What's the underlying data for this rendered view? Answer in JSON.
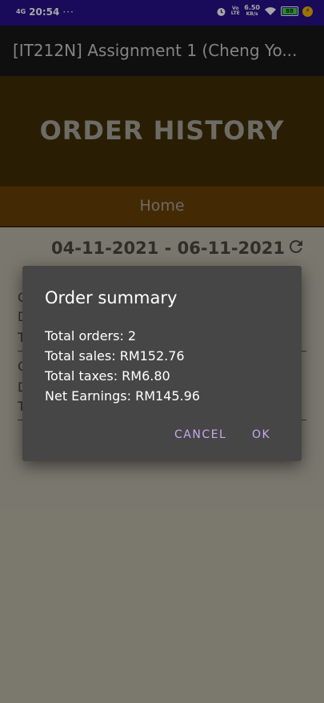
{
  "status_bar": {
    "network": "4G",
    "network_sub": "ıl",
    "time": "20:54",
    "dots": "···",
    "volte": "Vo LTE",
    "speed_value": "6.50",
    "speed_unit": "KB/s",
    "battery": "88"
  },
  "app_bar": {
    "title": "[IT212N] Assignment 1 (Cheng Yo..."
  },
  "banner": {
    "title": "ORDER HISTORY"
  },
  "nav": {
    "home_label": "Home"
  },
  "date_range": {
    "label": "04-11-2021 - 06-11-2021"
  },
  "background_list": {
    "letters": [
      "O",
      "D",
      "T",
      "O",
      "D",
      "T"
    ]
  },
  "dialog": {
    "title": "Order summary",
    "total_orders": "Total orders: 2",
    "total_sales": "Total sales: RM152.76",
    "total_taxes": "Total taxes: RM6.80",
    "net_earnings": "Net Earnings: RM145.96",
    "cancel_label": "CANCEL",
    "ok_label": "OK"
  },
  "colors": {
    "status_bar_bg": "#27128a",
    "banner_bg": "#3f2f05",
    "home_tab_bg": "#694107",
    "dialog_bg": "#464646",
    "dialog_button": "#c9a6f0"
  }
}
